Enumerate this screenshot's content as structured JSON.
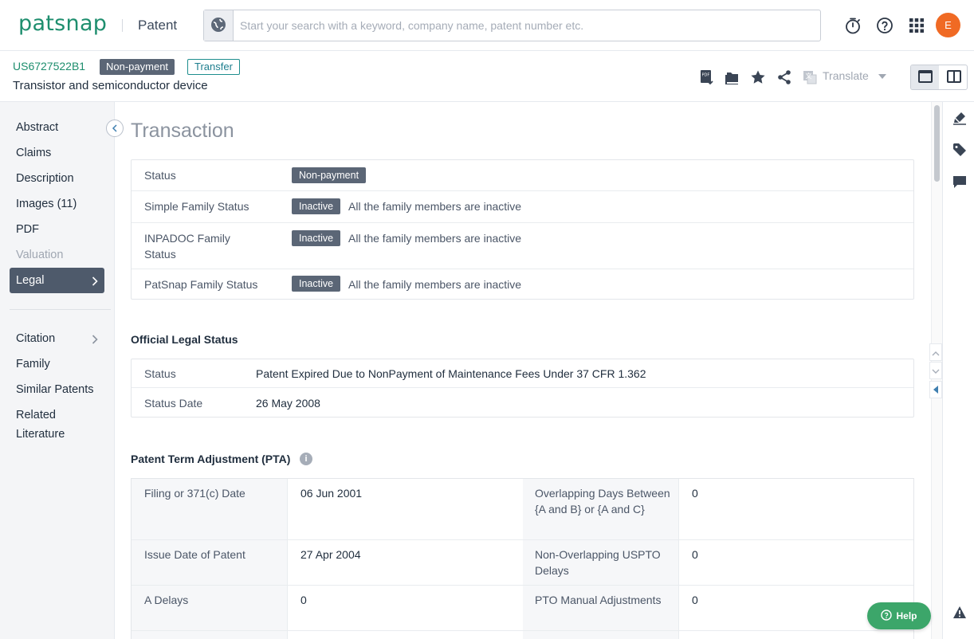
{
  "header": {
    "logo": "patsnap",
    "product": "Patent",
    "search_placeholder": "Start your search with a keyword, company name, patent number etc.",
    "avatar_initial": "E",
    "icons": [
      "globe-icon",
      "timer-icon",
      "help-circle-icon",
      "apps-grid-icon"
    ]
  },
  "patent": {
    "number": "US6727522B1",
    "status_badge": "Non-payment",
    "transfer_badge": "Transfer",
    "title": "Transistor and semiconductor device",
    "translate_label": "Translate"
  },
  "nav": {
    "items": [
      {
        "label": "Abstract"
      },
      {
        "label": "Claims"
      },
      {
        "label": "Description"
      },
      {
        "label": "Images (11)"
      },
      {
        "label": "PDF"
      },
      {
        "label": "Valuation"
      },
      {
        "label": "Legal"
      }
    ],
    "secondary": [
      {
        "label": "Citation"
      },
      {
        "label": "Family"
      },
      {
        "label": "Similar Patents"
      },
      {
        "label": "Related Literature"
      }
    ]
  },
  "transaction": {
    "title": "Transaction",
    "rows": [
      {
        "label": "Status",
        "chip": "Non-payment",
        "text": ""
      },
      {
        "label": "Simple Family Status",
        "chip": "Inactive",
        "text": "All the family members are inactive"
      },
      {
        "label": "INPADOC Family Status",
        "chip": "Inactive",
        "text": "All the family members are inactive"
      },
      {
        "label": "PatSnap Family Status",
        "chip": "Inactive",
        "text": "All the family members are inactive"
      }
    ]
  },
  "official": {
    "title": "Official Legal Status",
    "rows": [
      {
        "label": "Status",
        "value": "Patent Expired Due to NonPayment of Maintenance Fees Under 37 CFR 1.362"
      },
      {
        "label": "Status Date",
        "value": "26 May 2008"
      }
    ]
  },
  "pta": {
    "title": "Patent Term Adjustment (PTA)",
    "rows": [
      {
        "l1": "Filing or 371(c) Date",
        "v1": "06 Jun 2001",
        "l2": "Overlapping Days Between {A and B} or {A and C}",
        "v2": "0"
      },
      {
        "l1": "Issue Date of Patent",
        "v1": "27 Apr 2004",
        "l2": "Non-Overlapping USPTO Delays",
        "v2": "0"
      },
      {
        "l1": "A Delays",
        "v1": "0",
        "l2": "PTO Manual Adjustments",
        "v2": "0"
      }
    ]
  },
  "help": {
    "label": "Help"
  }
}
